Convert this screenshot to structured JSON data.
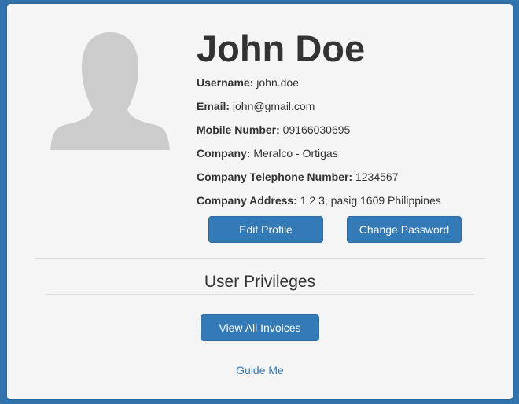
{
  "profile": {
    "name": "John Doe",
    "fields": [
      {
        "label": "Username:",
        "value": "john.doe"
      },
      {
        "label": "Email:",
        "value": "john@gmail.com"
      },
      {
        "label": "Mobile Number:",
        "value": "09166030695"
      },
      {
        "label": "Company:",
        "value": "Meralco - Ortigas"
      },
      {
        "label": "Company Telephone Number:",
        "value": "1234567"
      },
      {
        "label": "Company Address:",
        "value": "1 2 3, pasig 1609 Philippines"
      }
    ],
    "edit_label": "Edit Profile",
    "password_label": "Change Password"
  },
  "privileges": {
    "title": "User Privileges",
    "invoices_label": "View All Invoices"
  },
  "guide_label": "Guide Me",
  "colors": {
    "background": "#3173ac",
    "card": "#f5f5f5",
    "primary": "#337ab7",
    "text": "#333333",
    "avatar": "#cccccc"
  },
  "icons": {
    "avatar": "user-silhouette-icon"
  }
}
